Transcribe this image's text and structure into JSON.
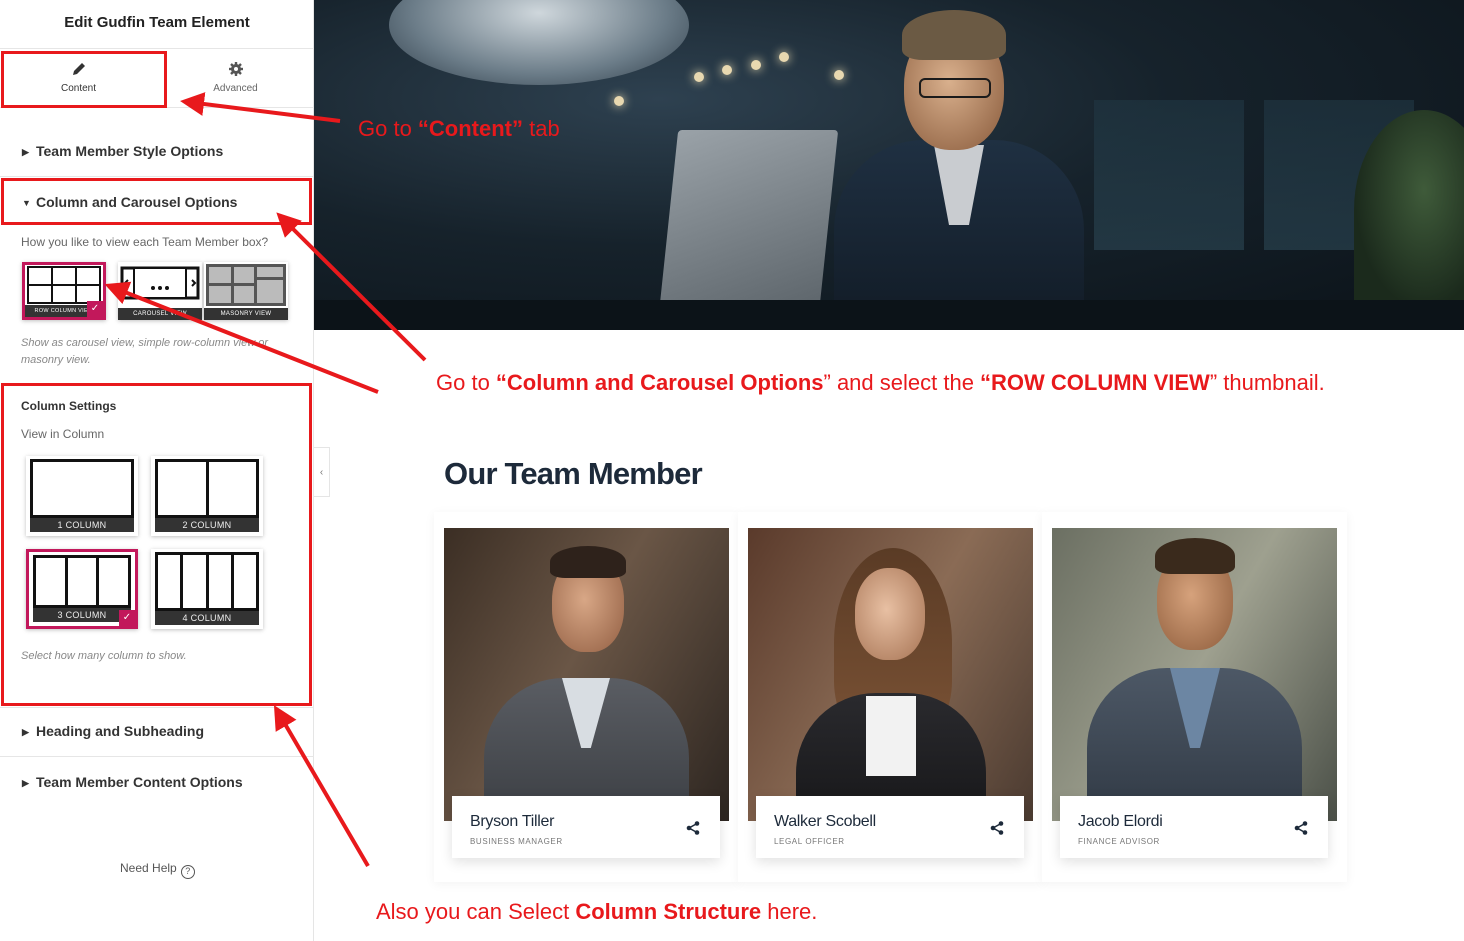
{
  "panel": {
    "title": "Edit Gudfin Team Element",
    "tabs": [
      {
        "label": "Content",
        "icon": "pencil-icon",
        "active": true
      },
      {
        "label": "Advanced",
        "icon": "gear-icon",
        "active": false
      }
    ],
    "sections": {
      "style": "Team Member Style Options",
      "column_carousel": "Column and Carousel Options",
      "heading": "Heading and Subheading",
      "content": "Team Member Content Options"
    },
    "view_question": "How you like to view each Team Member box?",
    "view_options": [
      {
        "label": "ROW COLUMN VIEW",
        "selected": true
      },
      {
        "label": "CAROUSEL VIEW",
        "selected": false
      },
      {
        "label": "MASONRY VIEW",
        "selected": false
      }
    ],
    "view_hint": "Show as carousel view, simple row-column view or masonry view.",
    "column_settings_title": "Column Settings",
    "view_in_column": "View in Column",
    "column_options": [
      {
        "label": "1 COLUMN",
        "columns": 1,
        "selected": false
      },
      {
        "label": "2 COLUMN",
        "columns": 2,
        "selected": false
      },
      {
        "label": "3 COLUMN",
        "columns": 3,
        "selected": true
      },
      {
        "label": "4 COLUMN",
        "columns": 4,
        "selected": false
      }
    ],
    "column_hint": "Select how many column to show.",
    "need_help": "Need Help",
    "collapse_icon": "chevron-left-icon"
  },
  "annotations": {
    "tab": {
      "pre": "Go  to ",
      "bold": "“Content”",
      "post": " tab"
    },
    "carousel": {
      "p1": "Go to ",
      "b1": "“Column and Carousel Options",
      "p2": "” and select the ",
      "b2": "“ROW COLUMN VIEW",
      "p3": "” thumbnail."
    },
    "column": {
      "pre": "Also you can Select ",
      "bold": "Column Structure",
      "post": " here."
    },
    "color": "#e8191c"
  },
  "preview": {
    "section_title": "Our Team Member",
    "members": [
      {
        "name": "Bryson Tiller",
        "role": "BUSINESS MANAGER",
        "icon": "share-icon"
      },
      {
        "name": "Walker Scobell",
        "role": "LEGAL OFFICER",
        "icon": "share-icon"
      },
      {
        "name": "Jacob Elordi",
        "role": "FINANCE ADVISOR",
        "icon": "share-icon"
      }
    ]
  },
  "colors": {
    "accent": "#c2185b",
    "annotation": "#e8191c",
    "heading": "#1d2a3a"
  }
}
